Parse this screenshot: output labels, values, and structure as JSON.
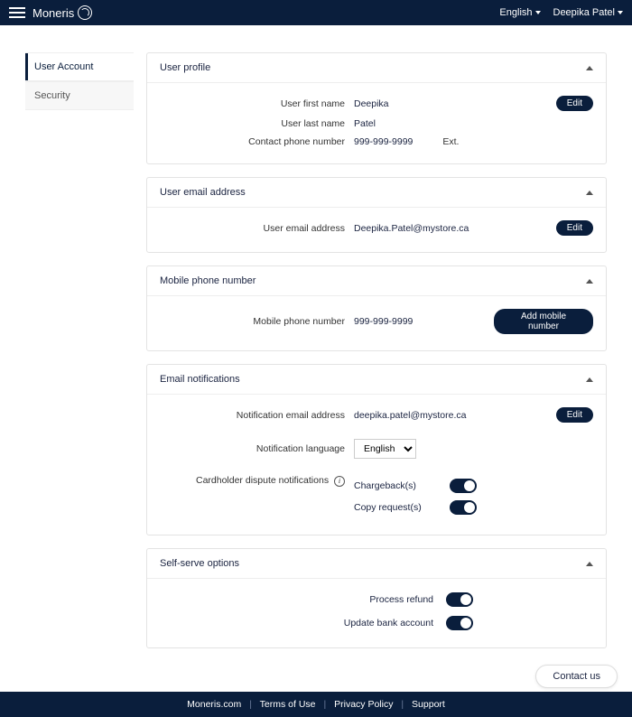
{
  "topbar": {
    "brand": "Moneris",
    "language": "English",
    "user": "Deepika Patel"
  },
  "sidebar": {
    "items": [
      {
        "label": "User Account",
        "active": true
      },
      {
        "label": "Security",
        "active": false
      }
    ]
  },
  "sections": {
    "profile": {
      "title": "User profile",
      "first_name_label": "User first name",
      "first_name_value": "Deepika",
      "last_name_label": "User last name",
      "last_name_value": "Patel",
      "phone_label": "Contact phone number",
      "phone_value": "999-999-9999",
      "ext_label": "Ext.",
      "edit_btn": "Edit"
    },
    "email": {
      "title": "User email address",
      "label": "User email address",
      "value": "Deepika.Patel@mystore.ca",
      "edit_btn": "Edit"
    },
    "mobile": {
      "title": "Mobile phone number",
      "label": "Mobile phone number",
      "value": "999-999-9999",
      "add_btn": "Add mobile number"
    },
    "notifications": {
      "title": "Email notifications",
      "email_label": "Notification email address",
      "email_value": "deepika.patel@mystore.ca",
      "edit_btn": "Edit",
      "lang_label": "Notification language",
      "lang_value": "English",
      "dispute_label": "Cardholder dispute notifications",
      "chargeback_label": "Chargeback(s)",
      "copy_request_label": "Copy request(s)"
    },
    "selfserve": {
      "title": "Self-serve options",
      "refund_label": "Process refund",
      "bank_label": "Update bank account"
    }
  },
  "contact_us": "Contact us",
  "footer": {
    "site": "Moneris.com",
    "terms": "Terms of Use",
    "privacy": "Privacy Policy",
    "support": "Support"
  }
}
